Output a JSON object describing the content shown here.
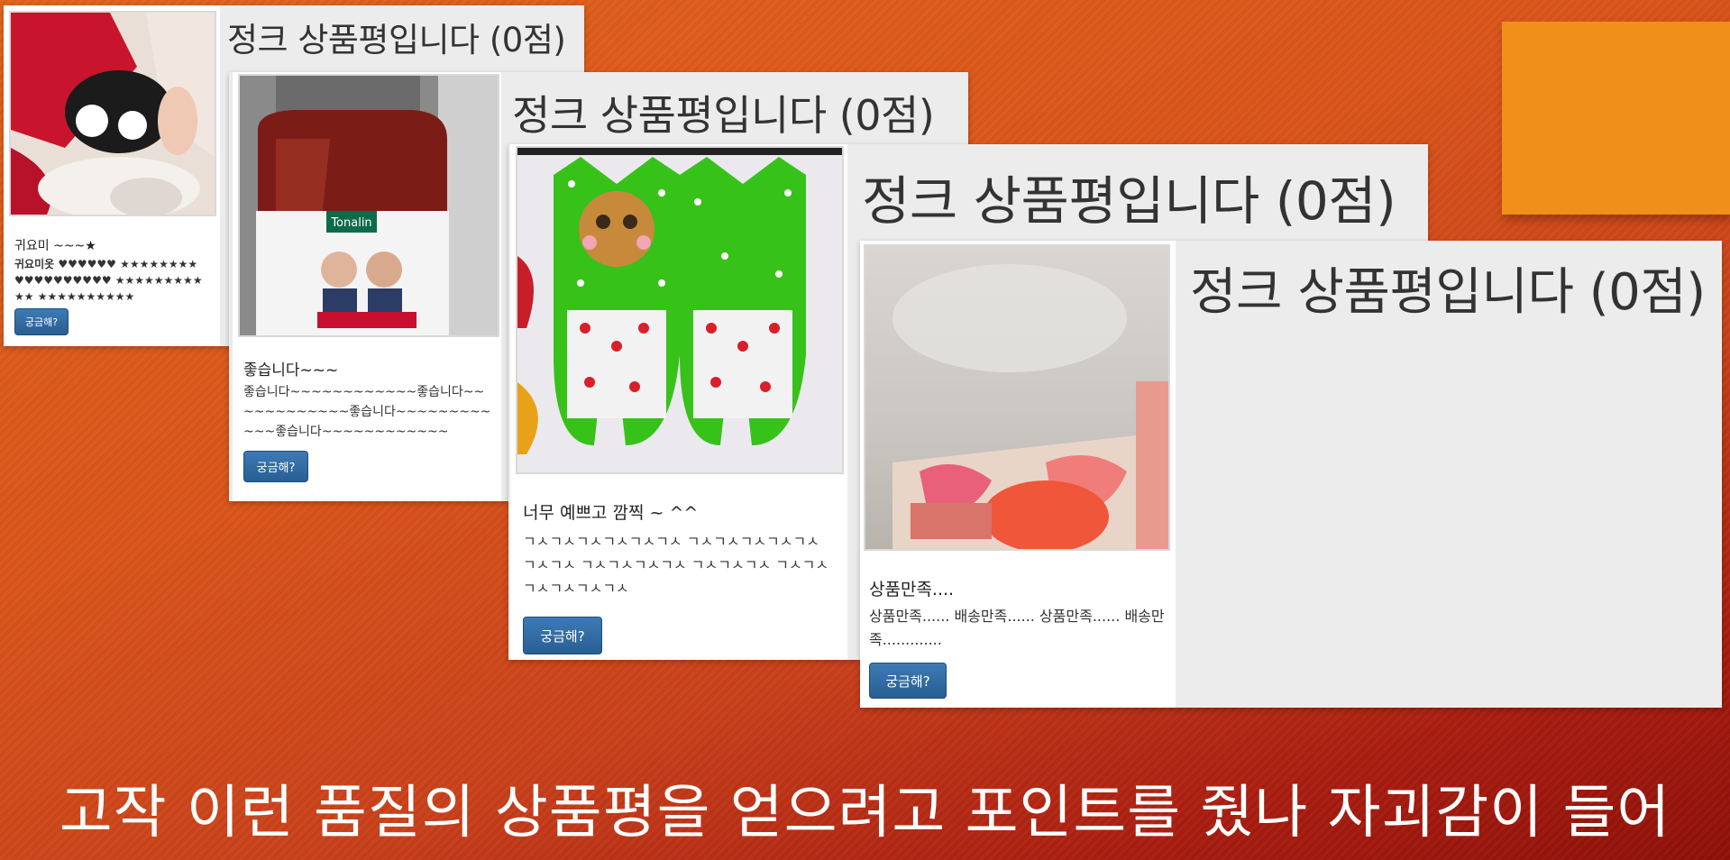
{
  "slide": {
    "caption": "고작 이런 품질의 상품평을 얻으려고 포인트를 줬나 자괴감이 들어",
    "accent_color": "#f0901a",
    "background_color": "#d9541a"
  },
  "screenshots": [
    {
      "header": "정크 상품평입니다 (0점)",
      "review_title": "귀요미 ~~~★",
      "review_body": "귀요미옷 ♥♥♥♥♥♥ ★★★★★★★★ ♥♥♥♥♥♥♥♥♥♥ ★★★★★★★★★★★ ★★★★★★★★★★",
      "button_label": "궁금해?",
      "photo_icon": "baby-in-mickey-outfit-photo"
    },
    {
      "header": "정크 상품평입니다 (0점)",
      "review_title": "좋습니다~~~",
      "review_body": "좋습니다~~~~~~~~~~~~좋습니다~~~~~~~~~~~~좋습니다~~~~~~~~~~~~좋습니다~~~~~~~~~~~~",
      "button_label": "궁금해?",
      "photo_icon": "supplement-bottle-photo",
      "photo_label": "Tonalin"
    },
    {
      "header": "정크 상품평입니다 (0점)",
      "review_title": "너무 예쁘고 깜찍 ~ ^^",
      "review_body": "ㄱㅅㄱㅅㄱㅅㄱㅅㄱㅅㄱㅅ ㄱㅅㄱㅅㄱㅅㄱㅅㄱㅅㄱㅅㄱㅅ ㄱㅅㄱㅅㄱㅅㄱㅅ ㄱㅅㄱㅅㄱㅅ ㄱㅅㄱㅅㄱㅅㄱㅅㄱㅅㄱㅅ",
      "button_label": "궁금해?",
      "photo_icon": "cat-pattern-fabric-photo"
    },
    {
      "header": "정크 상품평입니다 (0점)",
      "review_title": "상품만족....",
      "review_body": "상품만족...... 배송만족...... 상품만족...... 배송만족.............",
      "button_label": "궁금해?",
      "photo_icon": "blurry-lotion-bottle-photo"
    }
  ]
}
